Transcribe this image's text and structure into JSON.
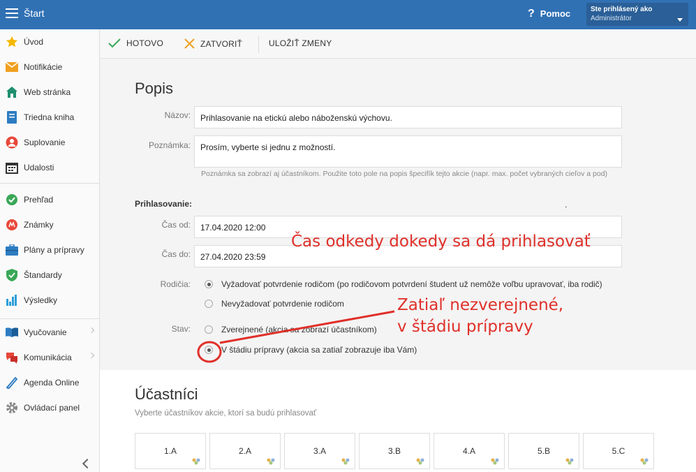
{
  "header": {
    "title": "Štart",
    "help_label": "Pomoc",
    "user_line1": "Ste prihlásený ako",
    "user_line2": "Administrátor"
  },
  "sidebar": {
    "items": [
      {
        "label": "Úvod",
        "icon": "star-icon"
      },
      {
        "label": "Notifikácie",
        "icon": "envelope-icon"
      },
      {
        "label": "Web stránka",
        "icon": "home-icon"
      },
      {
        "label": "Triedna kniha",
        "icon": "book-icon"
      },
      {
        "label": "Suplovanie",
        "icon": "user-icon"
      },
      {
        "label": "Udalosti",
        "icon": "calendar-icon"
      },
      {
        "label": "Prehľad",
        "icon": "check-circle-icon"
      },
      {
        "label": "Známky",
        "icon": "grade-icon"
      },
      {
        "label": "Plány a prípravy",
        "icon": "briefcase-icon"
      },
      {
        "label": "Štandardy",
        "icon": "shield-icon"
      },
      {
        "label": "Výsledky",
        "icon": "bar-chart-icon"
      },
      {
        "label": "Vyučovanie",
        "icon": "open-book-icon"
      },
      {
        "label": "Komunikácia",
        "icon": "chat-icon"
      },
      {
        "label": "Agenda Online",
        "icon": "pen-icon"
      },
      {
        "label": "Ovládací panel",
        "icon": "gear-icon"
      }
    ]
  },
  "toolbar": {
    "done_label": "HOTOVO",
    "close_label": "ZATVORIŤ",
    "save_label": "ULOŽIŤ ZMENY"
  },
  "form": {
    "section_title": "Popis",
    "name_label": "Názov:",
    "name_value": "Prihlasovanie na etickú alebo náboženskú výchovu.",
    "note_label": "Poznámka:",
    "note_value": "Prosím, vyberte si jednu z možností.",
    "note_hint": "Poznámka sa zobrazí aj účastníkom. Použite toto pole na popis špecifík tejto akcie (napr. max. počet vybraných cieľov a pod)",
    "signup_heading": "Prihlasovanie:",
    "from_label": "Čas od:",
    "from_value": "17.04.2020 12:00",
    "to_label": "Čas do:",
    "to_value": "27.04.2020 23:59",
    "parents_label": "Rodičia:",
    "parents_option1": "Vyžadovať potvrdenie rodičom (po rodičovom potvrdení študent už nemôže voľbu upravovať, iba rodič)",
    "parents_option2": "Nevyžadovať potvrdenie rodičom",
    "state_label": "Stav:",
    "state_option1": "Zverejnené (akcia sa zobrazí účastníkom)",
    "state_option2": "V štádiu prípravy (akcia sa zatiaľ zobrazuje iba Vám)",
    "dot_mark": "."
  },
  "annotations": {
    "time_note": "Čas odkedy dokedy sa dá prihlasovať",
    "state_note_line1": "Zatiaľ nezverejnené,",
    "state_note_line2": "v štádiu prípravy",
    "color": "#e0302a"
  },
  "participants": {
    "title": "Účastníci",
    "subtitle": "Vyberte účastníkov akcie, ktorí sa budú prihlasovať",
    "classes": [
      "1.A",
      "2.A",
      "3.A",
      "3.B",
      "4.A",
      "5.B",
      "5.C"
    ]
  },
  "colors": {
    "topbar": "#3071b4",
    "accent_red": "#e0302a",
    "check_green": "#3aa757",
    "close_orange": "#f0a020"
  }
}
